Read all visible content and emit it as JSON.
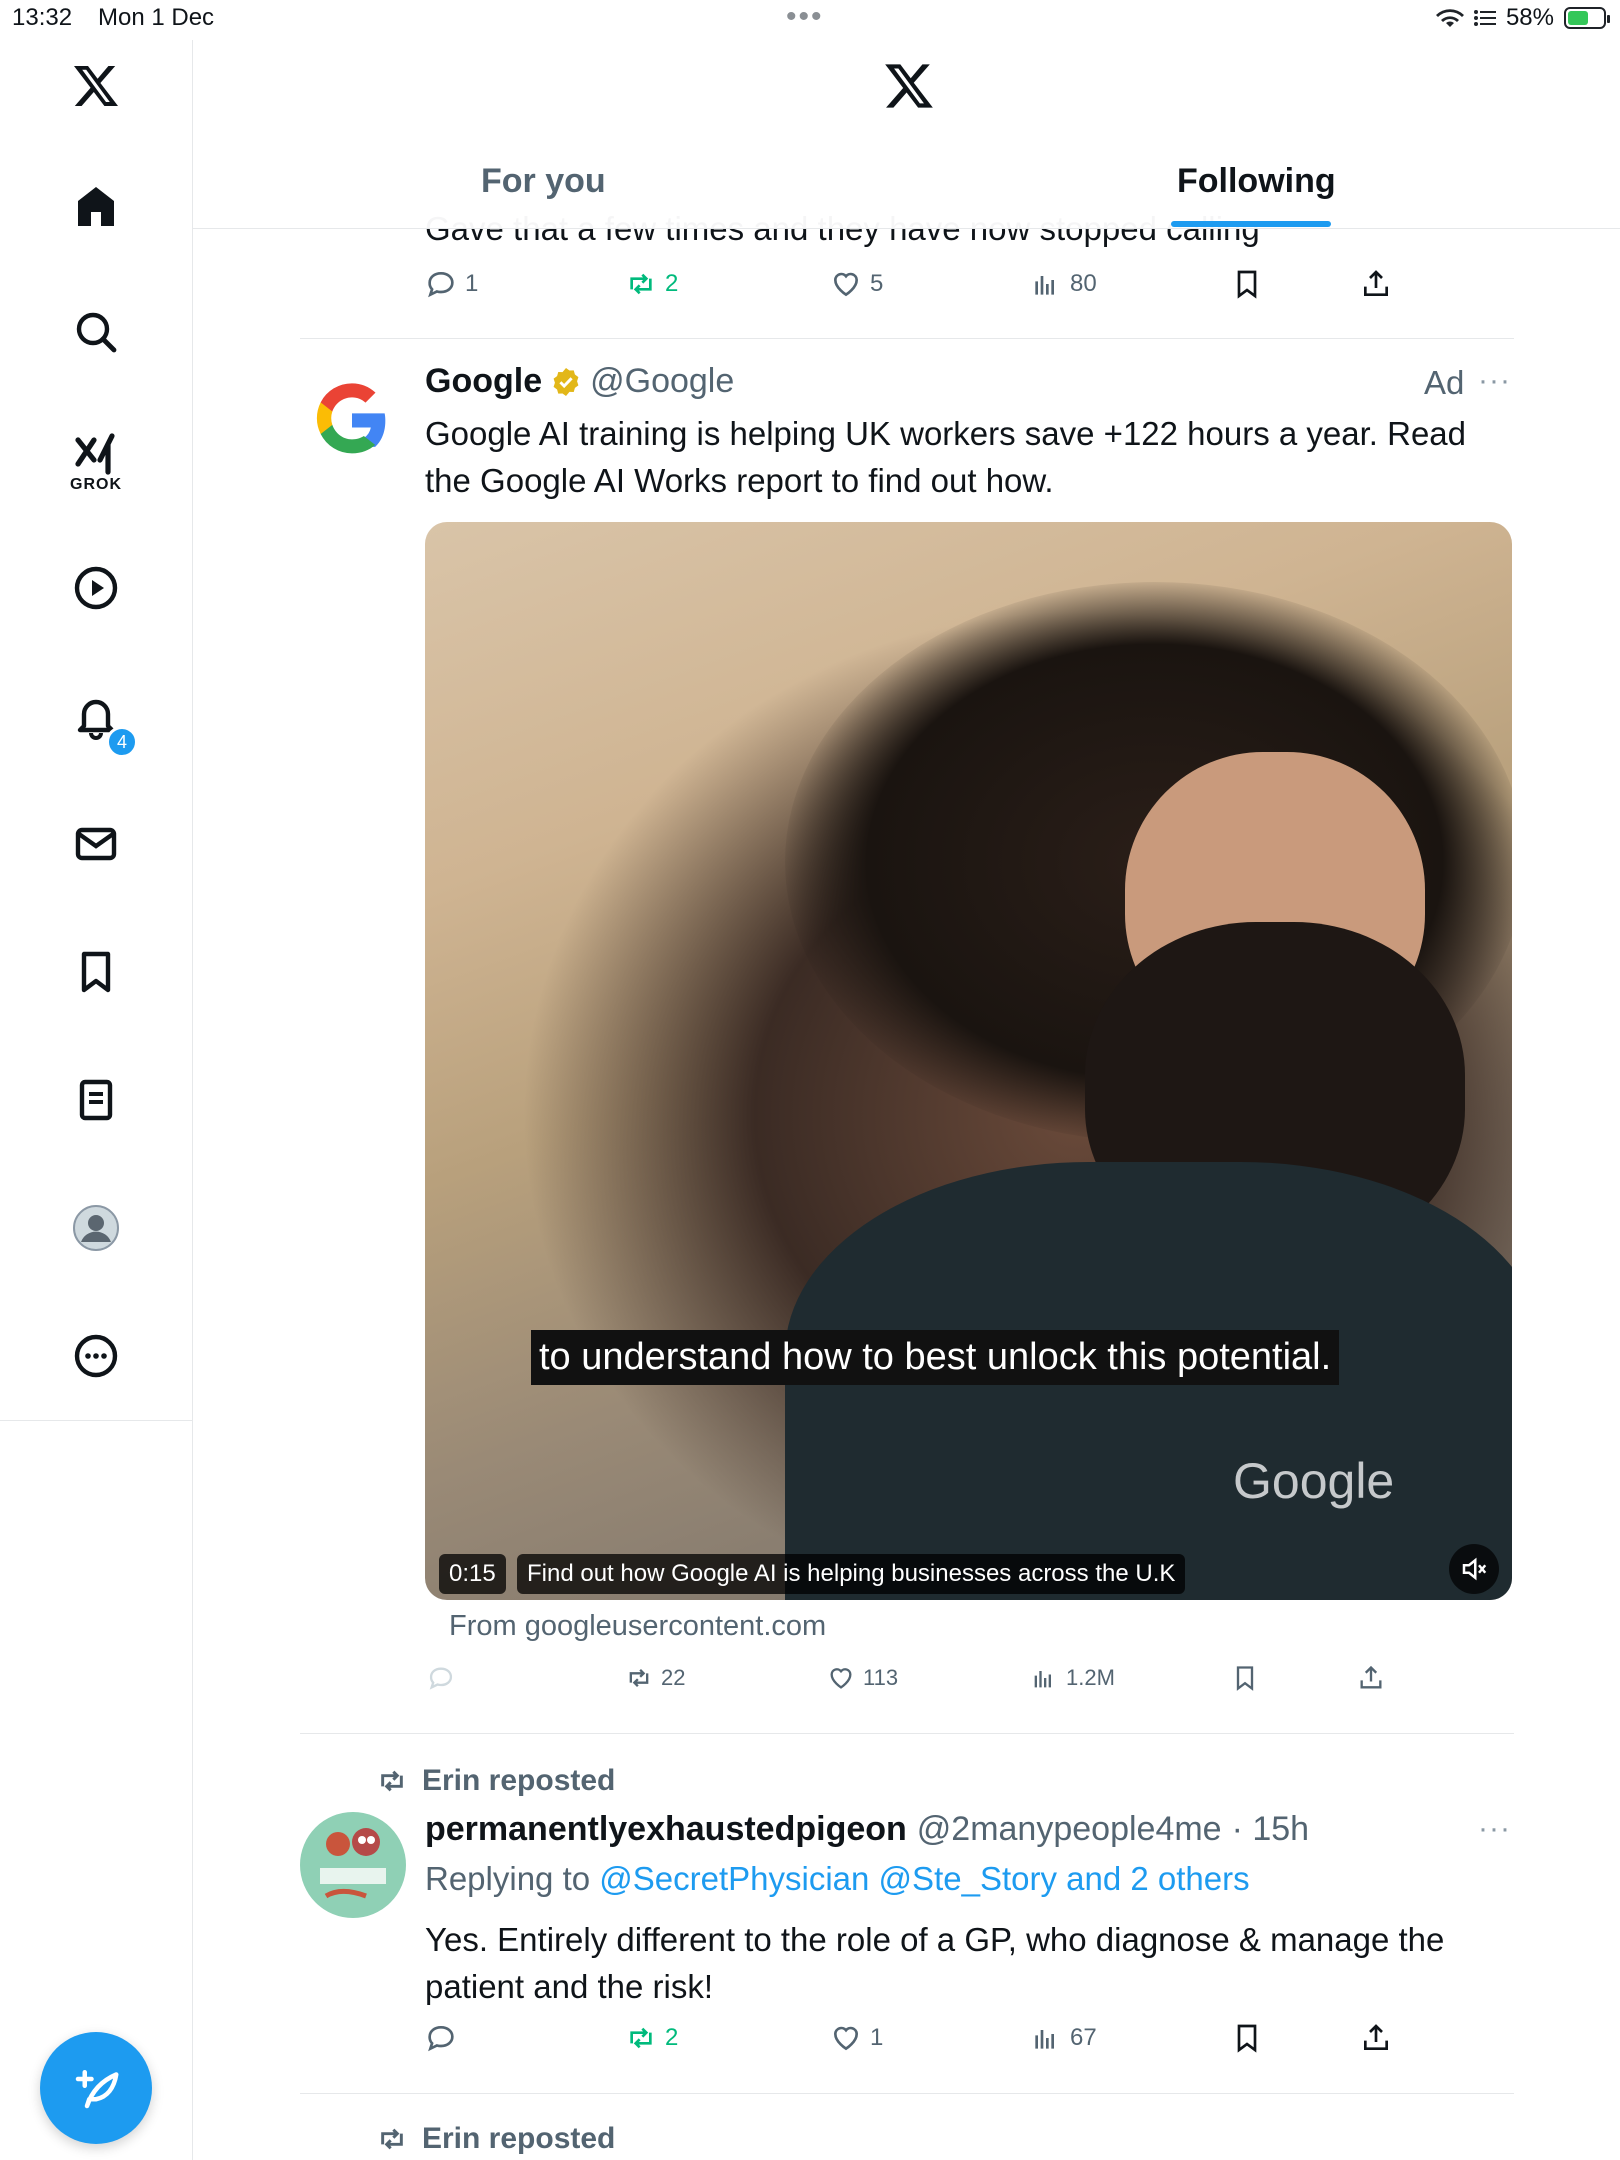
{
  "status_bar": {
    "time": "13:32",
    "date": "Mon 1 Dec",
    "battery": "58%",
    "battery_fraction": 0.58
  },
  "header": {
    "tabs": [
      {
        "label": "For you"
      },
      {
        "label": "Following"
      }
    ]
  },
  "sidebar": {
    "grok_label": "GROK",
    "notifications_badge": "4"
  },
  "feed": {
    "prev_post": {
      "partial_text": "Gave that a few times and they have now stopped calling",
      "replies": "1",
      "reposts": "2",
      "likes": "5",
      "views": "80"
    },
    "ad_post": {
      "name": "Google",
      "handle": "@Google",
      "ad_label": "Ad",
      "text": "Google AI training is helping UK workers save +122 hours a year. Read the Google AI Works report to find out how.",
      "video": {
        "caption": "to understand how to best unlock this potential.",
        "watermark": "Google",
        "time": "0:15",
        "title": "Find out how Google AI is helping businesses across the U.K"
      },
      "source": "From googleusercontent.com",
      "reposts": "22",
      "likes": "113",
      "views": "1.2M"
    },
    "repost_post": {
      "reposted_by": "Erin reposted",
      "name": "permanentlyexhaustedpigeon",
      "handle": "@2manypeople4me",
      "time": "· 15h",
      "replying_prefix": "Replying to",
      "replying_to": "@SecretPhysician @Ste_Story and 2 others",
      "text": "Yes. Entirely different to the role of a GP, who diagnose & manage the patient and the risk!",
      "reposts": "2",
      "likes": "1",
      "views": "67"
    },
    "next_post": {
      "reposted_by": "Erin reposted"
    }
  },
  "colors": {
    "accent": "#1d9bf0",
    "repost_green": "#00ba7c",
    "muted": "#536471"
  },
  "icons": [
    "x-logo-icon",
    "home-icon",
    "search-icon",
    "grok-icon",
    "video-icon",
    "bell-icon",
    "mail-icon",
    "bookmark-icon",
    "list-icon",
    "profile-icon",
    "more-icon",
    "compose-icon",
    "reply-icon",
    "repost-icon",
    "like-icon",
    "views-icon",
    "share-icon",
    "verified-icon",
    "mute-icon"
  ]
}
